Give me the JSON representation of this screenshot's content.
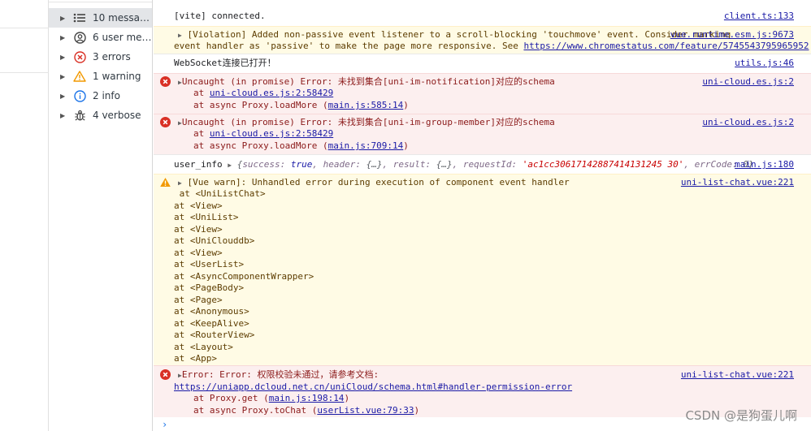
{
  "sidebar": {
    "items": [
      {
        "label": "10 messa…",
        "icon": "list-icon"
      },
      {
        "label": "6 user me…",
        "icon": "user-icon"
      },
      {
        "label": "3 errors",
        "icon": "error-icon"
      },
      {
        "label": "1 warning",
        "icon": "warning-icon"
      },
      {
        "label": "2 info",
        "icon": "info-icon"
      },
      {
        "label": "4 verbose",
        "icon": "bug-icon"
      }
    ]
  },
  "messages": {
    "m1": {
      "text": "[vite] connected.",
      "source": "client.ts:133"
    },
    "m2": {
      "text1": "[Violation] Added non-passive event listener to a scroll-blocking 'touchmove' event. Consider marking ",
      "source": "vue.runtime.esm.js:9673",
      "text2": "event handler as 'passive' to make the page more responsive. See ",
      "url": "https://www.chromestatus.com/feature/5745543795965952"
    },
    "m3": {
      "text": "WebSocket连接已打开！",
      "source": "utils.js:46"
    },
    "m4": {
      "text": "Uncaught (in promise) Error: 未找到集合[uni-im-notification]对应的schema",
      "source": "uni-cloud.es.js:2",
      "stack1_prefix": "at ",
      "stack1_link": "uni-cloud.es.js:2:58429",
      "stack2_prefix": "at async Proxy.loadMore (",
      "stack2_link": "main.js:585:14",
      "stack2_suffix": ")"
    },
    "m5": {
      "text": "Uncaught (in promise) Error: 未找到集合[uni-im-group-member]对应的schema",
      "source": "uni-cloud.es.js:2",
      "stack1_prefix": "at ",
      "stack1_link": "uni-cloud.es.js:2:58429",
      "stack2_prefix": "at async Proxy.loadMore (",
      "stack2_link": "main.js:709:14",
      "stack2_suffix": ")"
    },
    "m6": {
      "label": "user_info",
      "obj_open": "{",
      "k1": "success: ",
      "v1": "true",
      "k2": ", header: ",
      "v2": "{…}",
      "k3": ", result: ",
      "v3": "{…}",
      "k4": ", requestId: ",
      "v4": "'ac1cc30617142887414131245 30'",
      "k5": ", errCode: ",
      "v5": "0",
      "obj_close": "}",
      "source": "main.js:180"
    },
    "m7": {
      "text": "[Vue warn]: Unhandled error during execution of component event handler",
      "source": "uni-list-chat.vue:221",
      "stack": [
        " at <UniListChat>",
        "at <View>",
        "at <UniList>",
        "at <View>",
        "at <UniClouddb>",
        "at <View>",
        "at <UserList>",
        "at <AsyncComponentWrapper>",
        "at <PageBody>",
        "at <Page>",
        "at <Anonymous>",
        "at <KeepAlive>",
        "at <RouterView>",
        "at <Layout>",
        "at <App>"
      ]
    },
    "m8": {
      "text": "Error: Error: 权限校验未通过，请参考文档:",
      "source": "uni-list-chat.vue:221",
      "url": "https://uniapp.dcloud.net.cn/uniCloud/schema.html#handler-permission-error",
      "stack1_prefix": "at Proxy.get (",
      "stack1_link": "main.js:198:14",
      "stack1_suffix": ")",
      "stack2_prefix": "at async Proxy.toChat (",
      "stack2_link": "userList.vue:79:33",
      "stack2_suffix": ")"
    }
  },
  "prompt": "›",
  "watermark": "CSDN @是狗蛋儿啊",
  "colors": {
    "error_bg": "#fcefef",
    "warn_bg": "#fffbe5",
    "link": "#1a1aa6",
    "error_icon": "#d93025",
    "warn_icon": "#f29900"
  }
}
